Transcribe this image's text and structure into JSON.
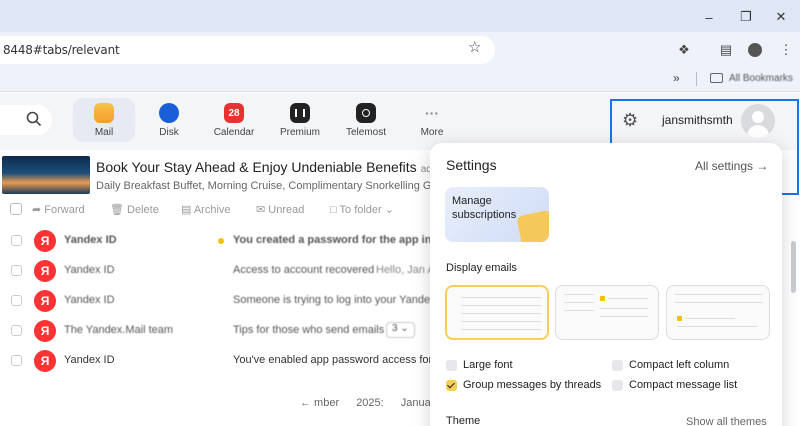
{
  "browser": {
    "url": "8448#tabs/relevant",
    "bookmarks_label": "All Bookmarks",
    "icons": [
      "minimize-icon",
      "restore-icon",
      "close-icon",
      "star-icon",
      "extensions-icon",
      "cast-icon",
      "profile-icon",
      "more-icon",
      "chevron-right-icon",
      "folder-icon"
    ]
  },
  "services": [
    {
      "label": "Mail",
      "icon": "mail-icon",
      "color": "#f5b342"
    },
    {
      "label": "Disk",
      "icon": "disk-icon",
      "color": "#1a5fd8"
    },
    {
      "label": "Calendar",
      "icon": "calendar-icon",
      "color": "#e8322f",
      "badge": "28"
    },
    {
      "label": "Premium",
      "icon": "premium-icon",
      "color": "#222222"
    },
    {
      "label": "Telemost",
      "icon": "telemost-icon",
      "color": "#222222"
    },
    {
      "label": "More",
      "icon": "more-icon",
      "color": "#888888"
    }
  ],
  "account": {
    "username": "jansmithsmth"
  },
  "ad": {
    "title": "Book Your Stay Ahead & Enjoy Undeniable Benefits",
    "tag": "ad",
    "subtitle": "Daily Breakfast Buffet, Morning Cruise, Complimentary Snorkelling Gear &"
  },
  "toolbar": {
    "forward": "Forward",
    "delete": "Delete",
    "archive": "Archive",
    "unread": "Unread",
    "to_folder": "To folder"
  },
  "messages": [
    {
      "from": "Yandex ID",
      "subject": "You created a password for the app in Yandex",
      "unread": true
    },
    {
      "from": "Yandex ID",
      "subject": "Access to account recovered",
      "extra": "Hello, Jan A"
    },
    {
      "from": "Yandex ID",
      "subject": "Someone is trying to log into your Yandex acc"
    },
    {
      "from": "The Yandex.Mail team",
      "subject": "Tips for those who send emails",
      "badge": "3"
    },
    {
      "from": "Yandex ID",
      "subject": "You've enabled app password access for this"
    }
  ],
  "pager": {
    "prev": "← mber",
    "year": "2025:",
    "month": "January"
  },
  "settings": {
    "title": "Settings",
    "all_settings": "All settings →",
    "manage_line1": "Manage",
    "manage_line2": "subscriptions",
    "display_emails": "Display emails",
    "large_font": "Large font",
    "group_threads": "Group messages by threads",
    "compact_left": "Compact left column",
    "compact_list": "Compact message list",
    "theme": "Theme",
    "show_themes": "Show all themes",
    "large_font_checked": false,
    "group_threads_checked": true,
    "compact_left_checked": false,
    "compact_list_checked": false
  }
}
